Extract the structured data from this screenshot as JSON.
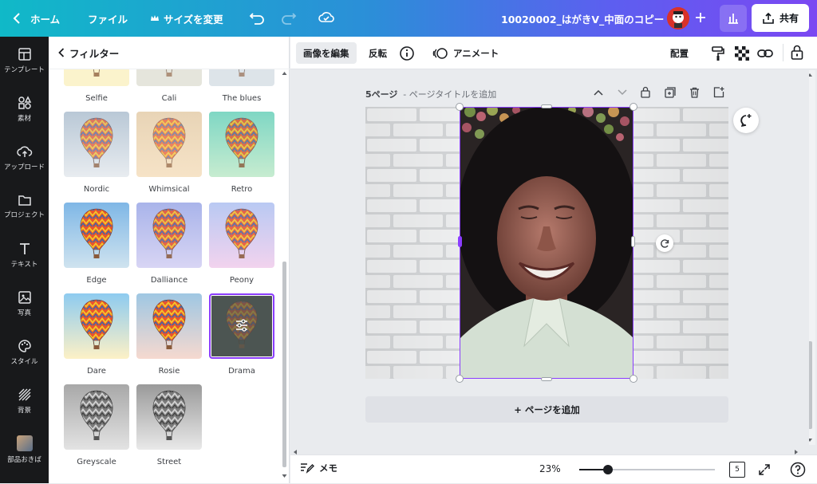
{
  "topbar": {
    "home_label": "ホーム",
    "file_label": "ファイル",
    "resize_label": "サイズを変更",
    "doc_title": "10020002_はがきV_中面のコピー",
    "share_label": "共有"
  },
  "sidebar": {
    "items": [
      {
        "label": "テンプレート"
      },
      {
        "label": "素材"
      },
      {
        "label": "アップロード"
      },
      {
        "label": "プロジェクト"
      },
      {
        "label": "テキスト"
      },
      {
        "label": "写真"
      },
      {
        "label": "スタイル"
      },
      {
        "label": "背景"
      },
      {
        "label": "部品おきば"
      }
    ]
  },
  "panel": {
    "title": "フィルター",
    "filters": [
      {
        "label": "Selfie"
      },
      {
        "label": "Cali"
      },
      {
        "label": "The blues"
      },
      {
        "label": "Nordic"
      },
      {
        "label": "Whimsical"
      },
      {
        "label": "Retro"
      },
      {
        "label": "Edge"
      },
      {
        "label": "Dalliance"
      },
      {
        "label": "Peony"
      },
      {
        "label": "Dare"
      },
      {
        "label": "Rosie"
      },
      {
        "label": "Drama",
        "selected": true
      },
      {
        "label": "Greyscale"
      },
      {
        "label": "Street"
      }
    ]
  },
  "toolbar": {
    "edit_image_label": "画像を編集",
    "flip_label": "反転",
    "animate_label": "アニメート",
    "position_label": "配置"
  },
  "canvas": {
    "page_number": "5ページ",
    "page_title_placeholder": "- ページタイトルを追加",
    "add_page_label": "+ ページを追加"
  },
  "bottombar": {
    "notes_label": "メモ",
    "zoom": "23%",
    "page_count": "5"
  },
  "colors": {
    "accent": "#8b3dff",
    "topbar_start": "#10b9c8",
    "topbar_end": "#7b48f2"
  }
}
